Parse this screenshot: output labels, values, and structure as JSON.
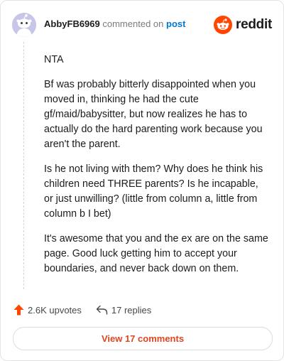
{
  "header": {
    "username": "AbbyFB6969",
    "action_text": "commented on",
    "target_text": "post",
    "avatar_icon": "snoo-avatar-icon",
    "brand_icon": "reddit-snoo-logo-icon",
    "brand_name": "reddit"
  },
  "comment": {
    "paragraphs": [
      "NTA",
      "Bf was probably bitterly disappointed when you moved in, thinking he had the cute gf/maid/babysitter, but now realizes he has to actually do the hard parenting work because you aren't the parent.",
      "Is he not living with them? Why does he think his children need THREE parents? Is he incapable, or just unwilling? (little from column a, little from column b I bet)",
      "It's awesome that you and the ex are on the same page. Good luck getting him to accept your boundaries, and never back down on them."
    ]
  },
  "actions": {
    "upvotes_label": "2.6K upvotes",
    "upvote_icon": "upvote-arrow-icon",
    "replies_label": "17 replies",
    "reply_icon": "reply-arrow-icon"
  },
  "footer": {
    "view_comments_label": "View 17 comments"
  },
  "colors": {
    "brand_orange": "#ff4500",
    "link_blue": "#0079d3",
    "button_text": "#e0451f",
    "avatar_bg": "#c7c6e8"
  }
}
